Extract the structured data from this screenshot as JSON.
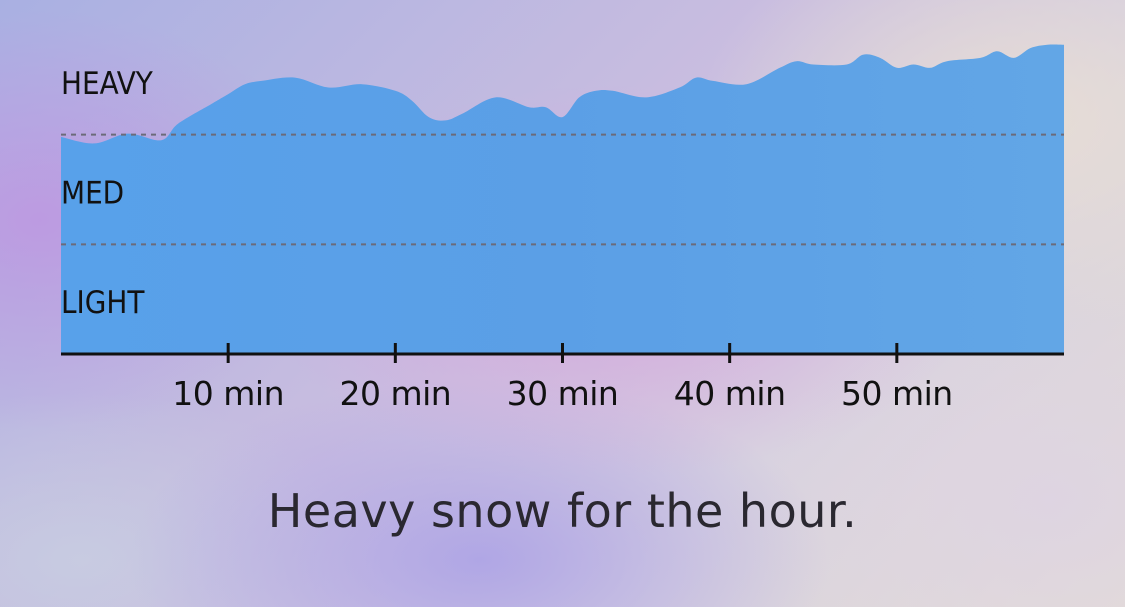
{
  "summary": "Heavy snow for the hour.",
  "chart_data": {
    "type": "area",
    "x": [
      0,
      2,
      4,
      6,
      7,
      9,
      10,
      11,
      12,
      14,
      16,
      18,
      20,
      21,
      22,
      23,
      24,
      26,
      28,
      29,
      30,
      31,
      32,
      33,
      35,
      37,
      38,
      39,
      41,
      43,
      44,
      45,
      47,
      48,
      49,
      50,
      51,
      52,
      53,
      55,
      56,
      57,
      58,
      59,
      60
    ],
    "y": [
      0.66,
      0.64,
      0.67,
      0.65,
      0.7,
      0.76,
      0.79,
      0.82,
      0.83,
      0.84,
      0.81,
      0.82,
      0.8,
      0.77,
      0.72,
      0.71,
      0.73,
      0.78,
      0.75,
      0.75,
      0.72,
      0.78,
      0.8,
      0.8,
      0.78,
      0.81,
      0.84,
      0.83,
      0.82,
      0.87,
      0.89,
      0.88,
      0.88,
      0.91,
      0.9,
      0.87,
      0.88,
      0.87,
      0.89,
      0.9,
      0.92,
      0.9,
      0.93,
      0.94,
      0.94
    ],
    "xlim": [
      0,
      60
    ],
    "ylim": [
      0,
      1
    ],
    "x_ticks": [
      {
        "value": 10,
        "label": "10 min"
      },
      {
        "value": 20,
        "label": "20 min"
      },
      {
        "value": 30,
        "label": "30 min"
      },
      {
        "value": 40,
        "label": "40 min"
      },
      {
        "value": 50,
        "label": "50 min"
      }
    ],
    "intensity_bands": [
      {
        "label": "HEAVY",
        "floor": 0.6667
      },
      {
        "label": "MED",
        "floor": 0.3333
      },
      {
        "label": "LIGHT",
        "floor": 0
      }
    ],
    "grid": "dashed lines at band boundaries",
    "colors": {
      "area": "#5aa5e8",
      "axis": "#111111",
      "gridline": "#6b6b7a"
    }
  }
}
